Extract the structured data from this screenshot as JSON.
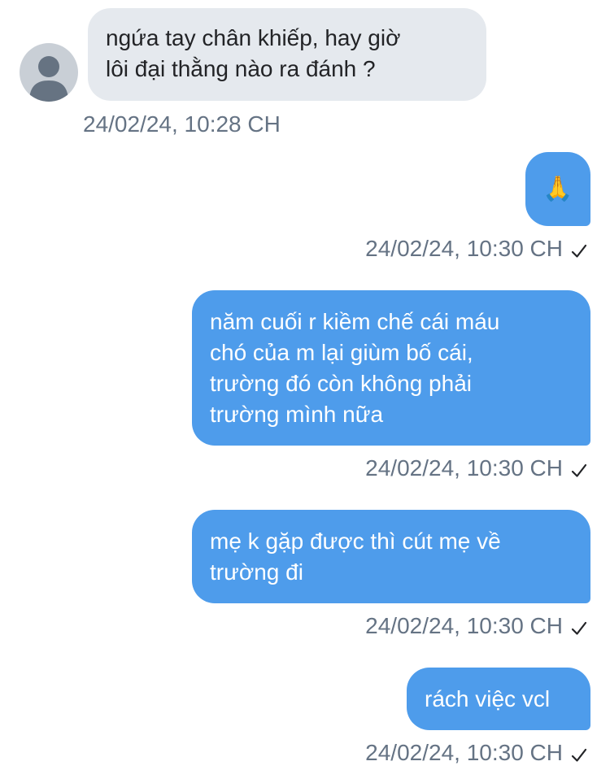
{
  "messages": [
    {
      "direction": "incoming",
      "text": "ngứa tay chân khiếp, hay giờ\nlôi đại thằng nào ra đánh ?",
      "timestamp": "24/02/24, 10:28 CH"
    },
    {
      "direction": "outgoing",
      "text": "🙏",
      "timestamp": "24/02/24, 10:30 CH",
      "status_icon": "check-icon"
    },
    {
      "direction": "outgoing",
      "text": "năm cuối r kiềm chế cái máu\nchó của m lại giùm bố cái,\ntrường đó còn không phải\ntrường mình nữa",
      "timestamp": "24/02/24, 10:30 CH",
      "status_icon": "check-icon"
    },
    {
      "direction": "outgoing",
      "text": "mẹ k gặp được thì cút mẹ về\ntrường đi",
      "timestamp": "24/02/24, 10:30 CH",
      "status_icon": "check-icon"
    },
    {
      "direction": "outgoing",
      "text": "rách việc vcl",
      "timestamp": "24/02/24, 10:30 CH",
      "status_icon": "check-icon"
    }
  ],
  "colors": {
    "incoming_bubble": "#e5e9ee",
    "outgoing_bubble": "#4e9ceb",
    "timestamp_text": "#657384"
  }
}
